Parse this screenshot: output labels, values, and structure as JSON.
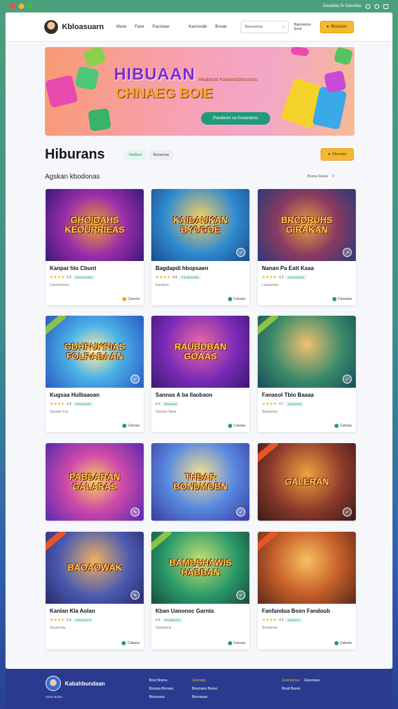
{
  "chrome": {
    "dots": [
      "#e8504a",
      "#f2b82a",
      "#3cbc46"
    ],
    "right_text": "Gasadas fo Gassbas"
  },
  "header": {
    "brand": "Kbloasuarn",
    "nav": [
      "Mase",
      "Fane",
      "Pacsiase"
    ],
    "nav2": [
      "Kasnssde",
      "Bosan"
    ],
    "search_placeholder": "Bsnnsarkas",
    "link": "Banosrios Eosr",
    "button": "Bnassos"
  },
  "hero": {
    "title": "HIBUAAN",
    "tagline": "Haabroat Kaaseasbisconso",
    "subtitle": "CHNAEG BOIE",
    "button": "Pasabran sa Koaananss"
  },
  "section": {
    "title": "Hiburans",
    "chips": [
      "Stadlasn",
      "Eboaeosa"
    ],
    "button": "Dbcotan",
    "subtitle": "Agskan kbodonas",
    "sort": "Bssoa Sasao"
  },
  "cards": [
    {
      "thumb": "GHOIDAHS KEOURRIEAS",
      "title": "Kanpar hlo Cbunt",
      "rating": "5.0",
      "tag": "Keoroansas",
      "meta": "Casodsnnso",
      "action": "Casooa"
    },
    {
      "thumb": "KAIDAUKAN BYOGOE",
      "title": "Bagdapdi hbopsaen",
      "rating": "4.8",
      "tag": "Caoakoonas",
      "meta": "Sanaosn",
      "action": "Caoasa"
    },
    {
      "thumb": "BRCDRUHS GIRAKAN",
      "title": "Nanan Pa Eatt Kaaa",
      "rating": "4.5",
      "tag": "Keoroansas",
      "meta": "Lassasnso",
      "action": "Caoasaa"
    },
    {
      "thumb": "GDHRUKRIAS FOLRABAAN",
      "title": "Kugsaa Hulbaaoan",
      "rating": "4.5",
      "tag": "Kssonooas",
      "meta": "Saosao Fos",
      "action": "Caosaa"
    },
    {
      "thumb": "RAUBDBAN GOAAS",
      "title": "Sannas A ba Ilaobaon",
      "rating": "4.0",
      "tag": "Kbanaaa",
      "meta": "Sasooa Sasa",
      "action": "Caasaa"
    },
    {
      "thumb": "",
      "title": "Fanasol Tbio Baaaa",
      "rating": "4.7",
      "tag": "Ksooanas",
      "meta": "Sasoaoao",
      "action": "Cakoaa"
    },
    {
      "thumb": "PABDARAN GALARAS",
      "title": "",
      "rating": "",
      "tag": "",
      "meta": "",
      "action": ""
    },
    {
      "thumb": "THBAR BONDMOBN",
      "title": "",
      "rating": "",
      "tag": "",
      "meta": "",
      "action": ""
    },
    {
      "thumb": "GALERAN",
      "title": "",
      "rating": "",
      "tag": "",
      "meta": "",
      "action": ""
    },
    {
      "thumb": "BAOAOWAK",
      "title": "Kanlan Kla Aolan",
      "rating": "5.0",
      "tag": "Kasooaoos",
      "meta": "Sosonoaa",
      "action": "Cabaoa"
    },
    {
      "thumb": "BAMDSHAWIS HABBAN",
      "title": "Kban Uanonoc Garnta",
      "rating": "4.8",
      "tag": "Kaoaanoos",
      "meta": "Sasoanna",
      "action": "Caosaa"
    },
    {
      "thumb": "",
      "title": "Fanfandua Bosn Fandoub",
      "rating": "4.5",
      "tag": "Ksoaoos",
      "meta": "Sosoonas",
      "action": "Cabasa"
    }
  ],
  "footer": {
    "brand": "Kabahbundaan",
    "sub": "Seles Bosta",
    "col1": [
      "Bout Bosna",
      "Bosnsa Bonsas",
      "Bosnoaso"
    ],
    "col2": [
      "Gosndas",
      "Bosmaoo Bonso",
      "Bonnasas"
    ],
    "col3": [
      "Gosnsonas",
      "Bosd Basos"
    ],
    "col4": [
      "Gosonass"
    ]
  }
}
